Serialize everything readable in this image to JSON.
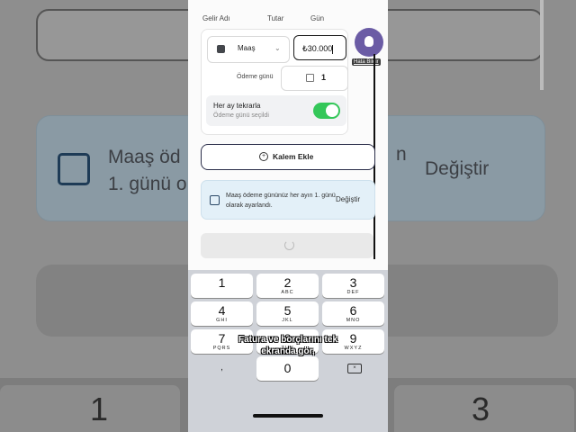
{
  "background": {
    "info_text_line1": "Maaş öd",
    "info_text_line2": "1. günü o",
    "info_text_tail": "n",
    "change_label": "Değiştir",
    "key_1": "1",
    "key_3": "3"
  },
  "header": {
    "col_source": "Gelir Adı",
    "col_amount": "Tutar",
    "col_day": "Gün"
  },
  "income": {
    "source_label": "Maaş",
    "amount_value": "₺30.000",
    "payment_day_label": "Ödeme günü",
    "payment_day_value": "1",
    "repeat_title": "Her ay tekrarla",
    "repeat_subtitle": "Ödeme günü seçildi",
    "repeat_enabled": true
  },
  "bug_report": {
    "tooltip": "Hata Bildir"
  },
  "add_item": {
    "label": "Kalem Ekle"
  },
  "info_banner": {
    "text": "Maaş ödeme gününüz her ayın 1. günü olarak ayarlandı.",
    "change_label": "Değiştir"
  },
  "keyboard": {
    "keys": [
      {
        "digit": "1",
        "letters": ""
      },
      {
        "digit": "2",
        "letters": "ABC"
      },
      {
        "digit": "3",
        "letters": "DEF"
      },
      {
        "digit": "4",
        "letters": "GHI"
      },
      {
        "digit": "5",
        "letters": "JKL"
      },
      {
        "digit": "6",
        "letters": "MNO"
      },
      {
        "digit": "7",
        "letters": "PQRS"
      },
      {
        "digit": "8",
        "letters": "TUV"
      },
      {
        "digit": "9",
        "letters": "WXYZ"
      },
      {
        "digit": "0",
        "letters": ""
      }
    ],
    "decimal_key": ","
  },
  "caption": {
    "line1": "Fatura ve borçlarını tek",
    "line2": "ekranda gör,"
  },
  "colors": {
    "toggle_on": "#34c759",
    "bug_button": "#6b5ca5",
    "info_bg": "#e3f0f8"
  }
}
